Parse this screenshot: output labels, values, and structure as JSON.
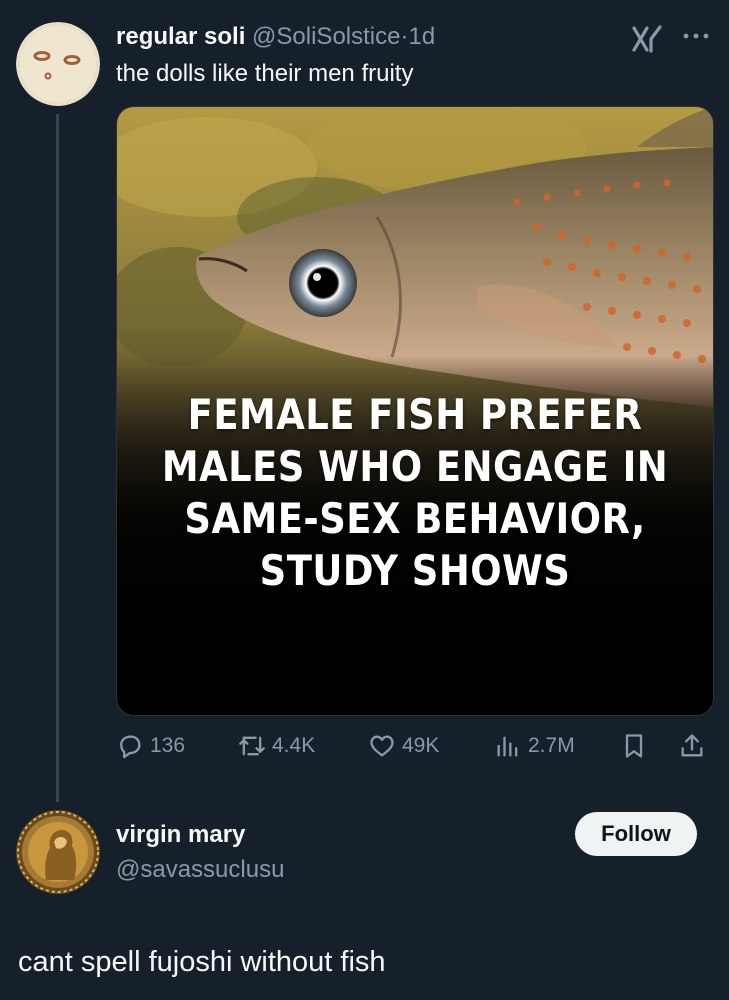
{
  "tweet": {
    "author_name": "regular soli",
    "author_handle": "@SoliSolstice",
    "separator": "·",
    "time": "1d",
    "text": "the dolls like their men fruity",
    "image_headline": "FEMALE FISH PREFER MALES WHO ENGAGE IN SAME-SEX BEHAVIOR, STUDY SHOWS",
    "stats": {
      "replies": "136",
      "retweets": "4.4K",
      "likes": "49K",
      "views": "2.7M"
    }
  },
  "reply": {
    "author_name": "virgin mary",
    "author_handle": "@savassuclusu",
    "follow_label": "Follow",
    "text": "cant spell fujoshi without fish"
  },
  "icons": {
    "grok": "grok-icon",
    "more": "more-icon",
    "reply": "reply-icon",
    "retweet": "retweet-icon",
    "like": "heart-icon",
    "views": "views-icon",
    "bookmark": "bookmark-icon",
    "share": "share-icon"
  },
  "colors": {
    "background": "#15202b",
    "text_primary": "#f7f9f9",
    "text_secondary": "#8b98a5",
    "thread_line": "#38444d",
    "follow_button_bg": "#eff3f4",
    "follow_button_text": "#0f1419"
  }
}
